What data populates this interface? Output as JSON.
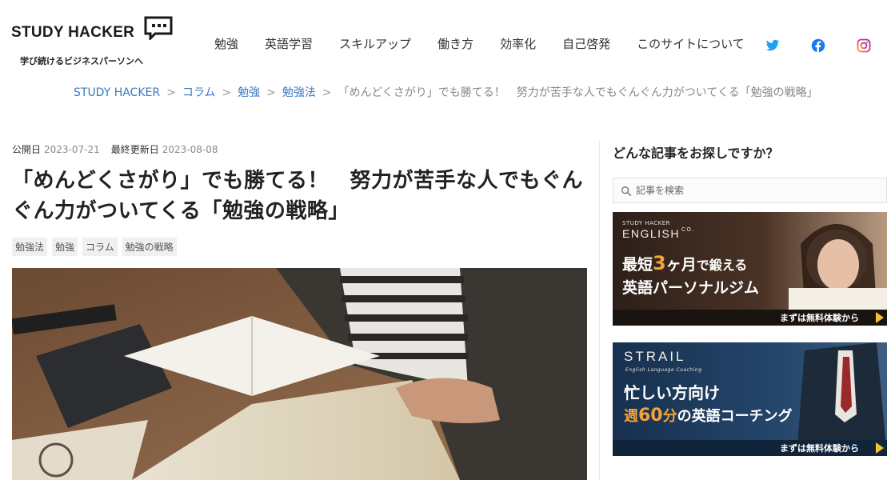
{
  "header": {
    "logo_text": "STUDY HACKER",
    "tagline": "学び続けるビジネスパーソンへ",
    "nav": [
      "勉強",
      "英語学習",
      "スキルアップ",
      "働き方",
      "効率化",
      "自己啓発",
      "このサイトについて"
    ],
    "social": [
      "twitter-icon",
      "facebook-icon",
      "instagram-icon"
    ]
  },
  "breadcrumb": {
    "items": [
      "STUDY HACKER",
      "コラム",
      "勉強",
      "勉強法"
    ],
    "current": "「めんどくさがり」でも勝てる！　努力が苦手な人でもぐんぐん力がついてくる「勉強の戦略」",
    "separator": ">"
  },
  "article": {
    "published_label": "公開日",
    "published": "2023-07-21",
    "updated_label": "最終更新日",
    "updated": "2023-08-08",
    "title": "「めんどくさがり」でも勝てる！　努力が苦手な人でもぐんぐん力がついてくる「勉強の戦略」",
    "tags": [
      "勉強法",
      "勉強",
      "コラム",
      "勉強の戦略"
    ]
  },
  "sidebar": {
    "title": "どんな記事をお探しですか？",
    "search_placeholder": "記事を検索",
    "banner1": {
      "small": "STUDY HACKER",
      "brand": "ENGLISH",
      "brand_suffix": "CO.",
      "line1_a": "最短",
      "line1_b": "3",
      "line1_c": "ヶ月",
      "line1_d": "で鍛える",
      "line2": "英語パーソナルジム",
      "cta": "まずは無料体験から"
    },
    "banner2": {
      "brand": "STRAIL",
      "small": "English Language Coaching",
      "line1": "忙しい方向け",
      "line2_a": "週",
      "line2_b": "60",
      "line2_c": "分",
      "line2_d": "の英語コーチング",
      "cta": "まずは無料体験から"
    }
  },
  "colors": {
    "link": "#3a7bbf",
    "twitter": "#1da1f2",
    "facebook": "#1877f2",
    "instagram": "#d6249f",
    "accent_orange": "#f2a33a",
    "cta_arrow": "#f2c230"
  }
}
